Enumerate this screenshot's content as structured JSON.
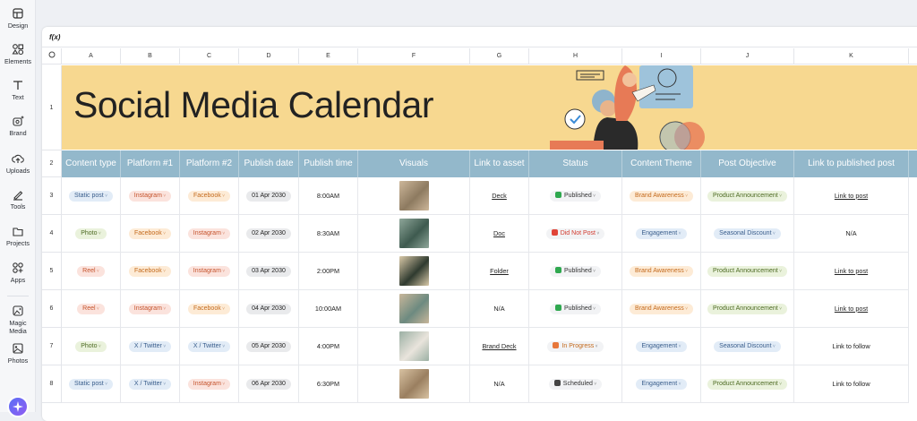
{
  "sidebar": {
    "items": [
      {
        "label": "Design",
        "icon": "design-icon"
      },
      {
        "label": "Elements",
        "icon": "elements-icon"
      },
      {
        "label": "Text",
        "icon": "text-icon"
      },
      {
        "label": "Brand",
        "icon": "brand-icon"
      },
      {
        "label": "Uploads",
        "icon": "uploads-icon"
      },
      {
        "label": "Tools",
        "icon": "tools-icon"
      },
      {
        "label": "Projects",
        "icon": "projects-icon"
      },
      {
        "label": "Apps",
        "icon": "apps-icon"
      },
      {
        "label": "Magic Media",
        "icon": "magic-media-icon"
      },
      {
        "label": "Photos",
        "icon": "photos-icon"
      }
    ]
  },
  "formula_bar": {
    "label": "f(x)"
  },
  "columns": [
    "A",
    "B",
    "C",
    "D",
    "E",
    "F",
    "G",
    "H",
    "I",
    "J",
    "K"
  ],
  "rows": [
    "1",
    "2",
    "3",
    "4",
    "5",
    "6",
    "7",
    "8"
  ],
  "banner": {
    "title": "Social Media Calendar",
    "color": "#f7d890"
  },
  "table": {
    "header_color": "#93b8cb",
    "headers": [
      "Content type",
      "Platform #1",
      "Platform #2",
      "Publish date",
      "Publish time",
      "Visuals",
      "Link to asset",
      "Status",
      "Content Theme",
      "Post Objective",
      "Link to published post"
    ],
    "rows": [
      {
        "type": "Static post",
        "p1": "Instagram",
        "p2": "Facebook",
        "date": "01 Apr 2030",
        "time": "8:00AM",
        "asset": "Deck",
        "status": "Published",
        "theme": "Brand Awareness",
        "objective": "Product Announcement",
        "link": "Link to post"
      },
      {
        "type": "Photo",
        "p1": "Facebook",
        "p2": "Instagram",
        "date": "02 Apr 2030",
        "time": "8:30AM",
        "asset": "Doc",
        "status": "Did Not Post",
        "theme": "Engagement",
        "objective": "Seasonal Discount",
        "link": "N/A"
      },
      {
        "type": "Reel",
        "p1": "Facebook",
        "p2": "Instagram",
        "date": "03 Apr 2030",
        "time": "2:00PM",
        "asset": "Folder",
        "status": "Published",
        "theme": "Brand Awareness",
        "objective": "Product Announcement",
        "link": "Link to post"
      },
      {
        "type": "Reel",
        "p1": "Instagram",
        "p2": "Facebook",
        "date": "04 Apr 2030",
        "time": "10:00AM",
        "asset": "N/A",
        "status": "Published",
        "theme": "Brand Awareness",
        "objective": "Product Announcement",
        "link": "Link to post"
      },
      {
        "type": "Photo",
        "p1": "X / Twitter",
        "p2": "X / Twitter",
        "date": "05 Apr 2030",
        "time": "4:00PM",
        "asset": "Brand Deck",
        "status": "In Progress",
        "theme": "Engagement",
        "objective": "Seasonal Discount",
        "link": "Link to follow"
      },
      {
        "type": "Static post",
        "p1": "X / Twitter",
        "p2": "Instagram",
        "date": "06 Apr 2030",
        "time": "6:30PM",
        "asset": "N/A",
        "status": "Scheduled",
        "theme": "Engagement",
        "objective": "Product Announcement",
        "link": "Link to follow"
      }
    ]
  }
}
